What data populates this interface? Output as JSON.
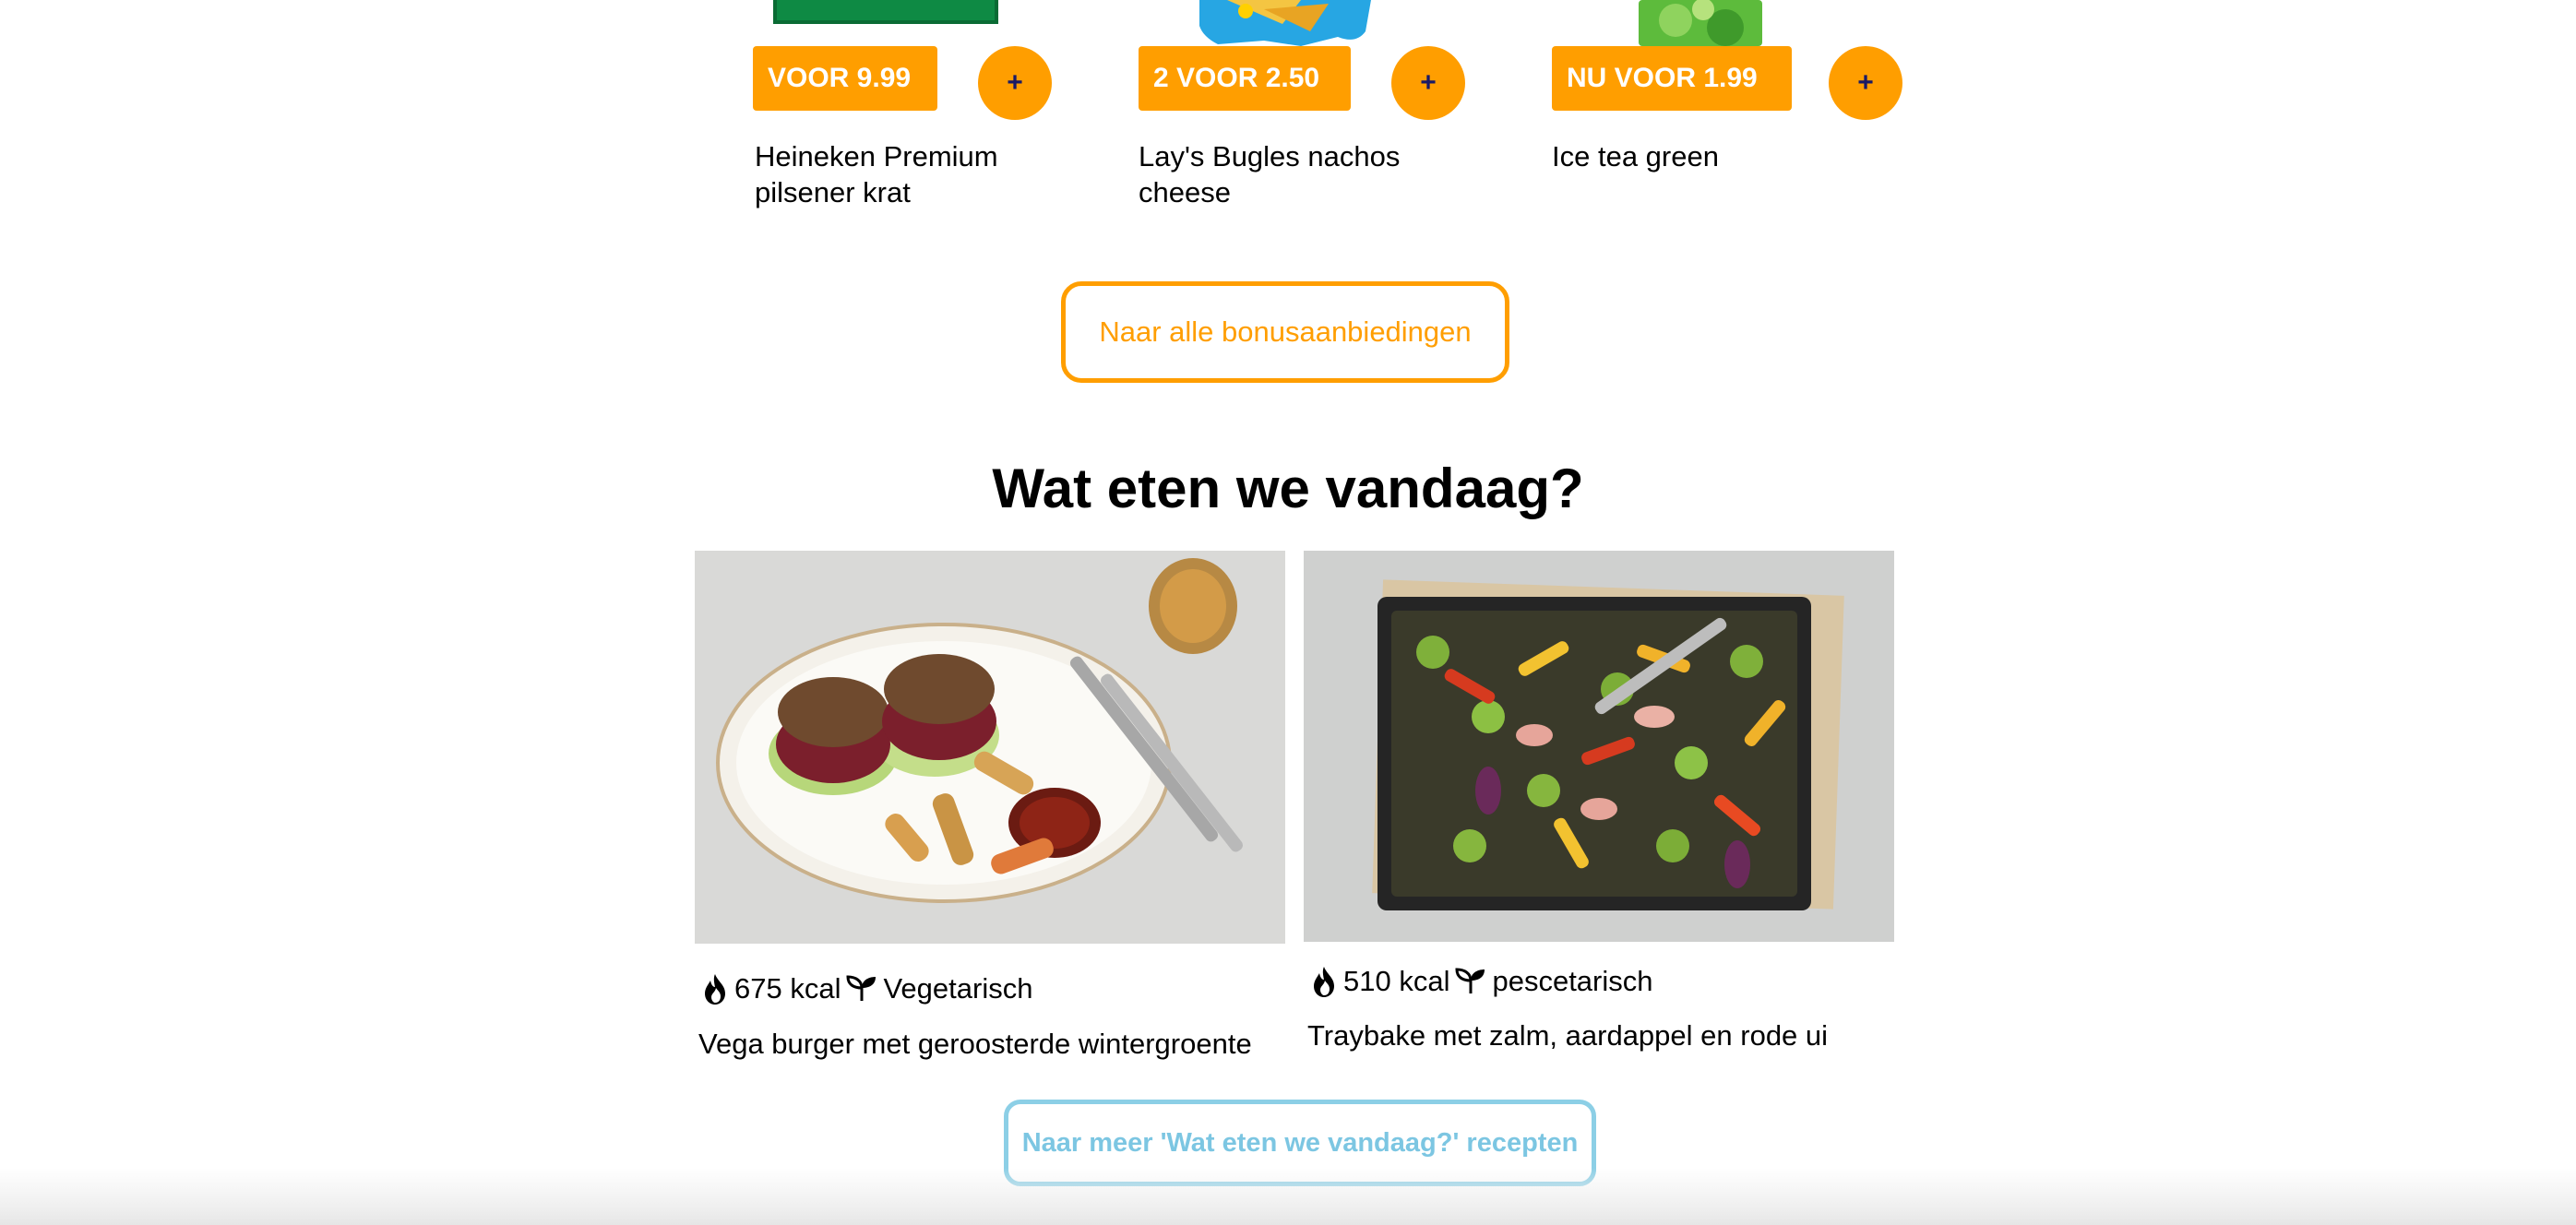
{
  "products": [
    {
      "badge": "VOOR 9.99",
      "name": "Heineken Premium pilsener krat",
      "add_label": "+"
    },
    {
      "badge": "2 VOOR 2.50",
      "name": "Lay's Bugles nachos cheese",
      "add_label": "+"
    },
    {
      "badge": "NU VOOR 1.99",
      "name": "Ice tea green",
      "add_label": "+"
    }
  ],
  "bonus_button": {
    "label": "Naar alle bonusaanbiedingen"
  },
  "section": {
    "title": "Wat eten we vandaag?"
  },
  "recipes": [
    {
      "kcal": "675 kcal",
      "diet": "Vegetarisch",
      "title": "Vega burger met geroosterde wintergroente"
    },
    {
      "kcal": "510 kcal",
      "diet": "pescetarisch",
      "title": "Traybake met zalm, aardappel en rode ui"
    }
  ],
  "more_recipes_button": {
    "label": "Naar meer 'Wat eten we vandaag?' recepten"
  },
  "colors": {
    "accent": "#ff9e00",
    "secondary": "#8ccfe6",
    "text": "#000000"
  }
}
